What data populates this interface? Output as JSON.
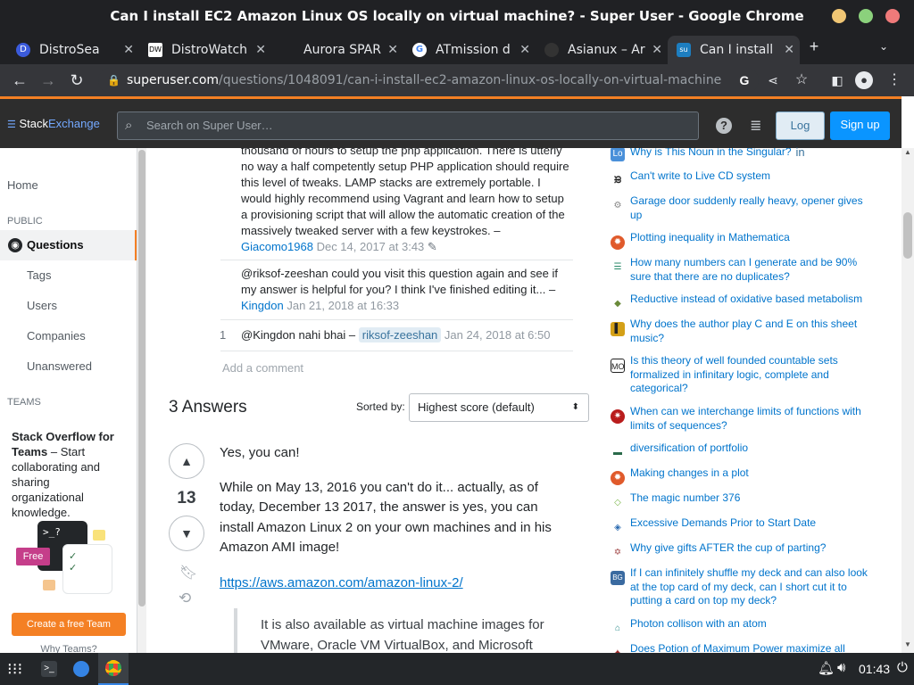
{
  "window": {
    "title": "Can I install EC2 Amazon Linux OS locally on virtual machine? - Super User - Google Chrome"
  },
  "tabs": [
    {
      "label": "DistroSea",
      "icon": "D"
    },
    {
      "label": "DistroWatch",
      "icon": "DW"
    },
    {
      "label": "Aurora SPAR",
      "icon": ""
    },
    {
      "label": "ATmission d",
      "icon": "G"
    },
    {
      "label": "Asianux – Ar",
      "icon": ""
    },
    {
      "label": "Can I install",
      "icon": "su"
    }
  ],
  "address": {
    "domain": "superuser.com",
    "path": "/questions/1048091/can-i-install-ec2-amazon-linux-os-locally-on-virtual-machine"
  },
  "se_header": {
    "logo_a": "Stack",
    "logo_b": "Exchange",
    "search_placeholder": "Search on Super User…",
    "login": "Log in",
    "signup": "Sign up"
  },
  "leftnav": {
    "home": "Home",
    "public": "PUBLIC",
    "questions": "Questions",
    "tags": "Tags",
    "users": "Users",
    "companies": "Companies",
    "unanswered": "Unanswered",
    "teams": "TEAMS",
    "teams_title": "Stack Overflow for Teams",
    "teams_desc": " – Start collaborating and sharing organizational knowledge.",
    "free_badge": "Free",
    "create_team": "Create a free Team",
    "why_teams": "Why Teams?"
  },
  "comments": [
    {
      "text": "thousand of hours to setup the php application. There is utterly no way a half competently setup PHP application should require this level of tweaks. LAMP stacks are extremely portable. I would highly recommend using Vagrant and learn how to setup a provisioning script that will allow the automatic creation of the massively tweaked server with a few keystrokes.",
      "user": "Giacomo1968",
      "date": "Dec 14, 2017 at 3:43"
    },
    {
      "text": "@riksof-zeeshan could you visit this question again and see if my answer is helpful for you? I think I've finished editing it...",
      "user": "Kingdon",
      "date": "Jan 21, 2018 at 16:33"
    },
    {
      "score": "1",
      "text": "@Kingdon nahi bhai – ",
      "user": "riksof-zeeshan",
      "date": "Jan 24, 2018 at 6:50"
    }
  ],
  "add_comment": "Add a comment",
  "answers": {
    "count_label": "3 Answers",
    "sorted_by": "Sorted by:",
    "sort_value": "Highest score (default)"
  },
  "answer": {
    "score": "13",
    "p1": "Yes, you can!",
    "p2": "While on May 13, 2016 you can't do it... actually, as of today, December 13 2017, the answer is yes, you can install Amazon Linux 2 on your own machines and in his Amazon AMI image!",
    "link": "https://aws.amazon.com/amazon-linux-2/",
    "quote": "It is also available as virtual machine images for VMware, Oracle VM VirtualBox, and Microsoft"
  },
  "hot_questions": [
    {
      "text": "Why is This Noun in the Singular?",
      "icon": "ell-icon",
      "color": "#4a90d9"
    },
    {
      "text": "Can't write to Live CD system",
      "icon": "unix-icon",
      "color": "#222222"
    },
    {
      "text": "Garage door suddenly really heavy, opener gives up",
      "icon": "diy-icon",
      "color": "#888888"
    },
    {
      "text": "Plotting inequality in Mathematica",
      "icon": "mathematica-icon",
      "color": "#e05a2b"
    },
    {
      "text": "How many numbers can I generate and be 90% sure that there are no duplicates?",
      "icon": "stats-icon",
      "color": "#2a8a6a"
    },
    {
      "text": "Reductive instead of oxidative based metabolism",
      "icon": "biology-icon",
      "color": "#6a8a3a"
    },
    {
      "text": "Why does the author play C and E on this sheet music?",
      "icon": "music-icon",
      "color": "#d4a017"
    },
    {
      "text": "Is this theory of well founded countable sets formalized in infinitary logic, complete and categorical?",
      "icon": "mo-icon",
      "color": "#222222"
    },
    {
      "text": "When can we interchange limits of functions with limits of sequences?",
      "icon": "math-icon",
      "color": "#b91c1c"
    },
    {
      "text": "diversification of portfolio",
      "icon": "money-icon",
      "color": "#2a6a4a"
    },
    {
      "text": "Making changes in a plot",
      "icon": "mathematica-icon",
      "color": "#e05a2b"
    },
    {
      "text": "The magic number 376",
      "icon": "puzzling-icon",
      "color": "#7ab648"
    },
    {
      "text": "Excessive Demands Prior to Start Date",
      "icon": "workplace-icon",
      "color": "#2a6ab0"
    },
    {
      "text": "Why give gifts AFTER the cup of parting?",
      "icon": "judaism-icon",
      "color": "#9a3a3a"
    },
    {
      "text": "If I can infinitely shuffle my deck and can also look at the top card of my deck, can I short cut it to putting a card on top my deck?",
      "icon": "boardgames-icon",
      "color": "#3a6aa0"
    },
    {
      "text": "Photon collison with an atom",
      "icon": "physics-icon",
      "color": "#2a8a8a"
    },
    {
      "text": "Does Potion of Maximum Power maximize all",
      "icon": "rpg-icon",
      "color": "#9a2a2a"
    }
  ],
  "taskbar": {
    "time": "01:43"
  }
}
